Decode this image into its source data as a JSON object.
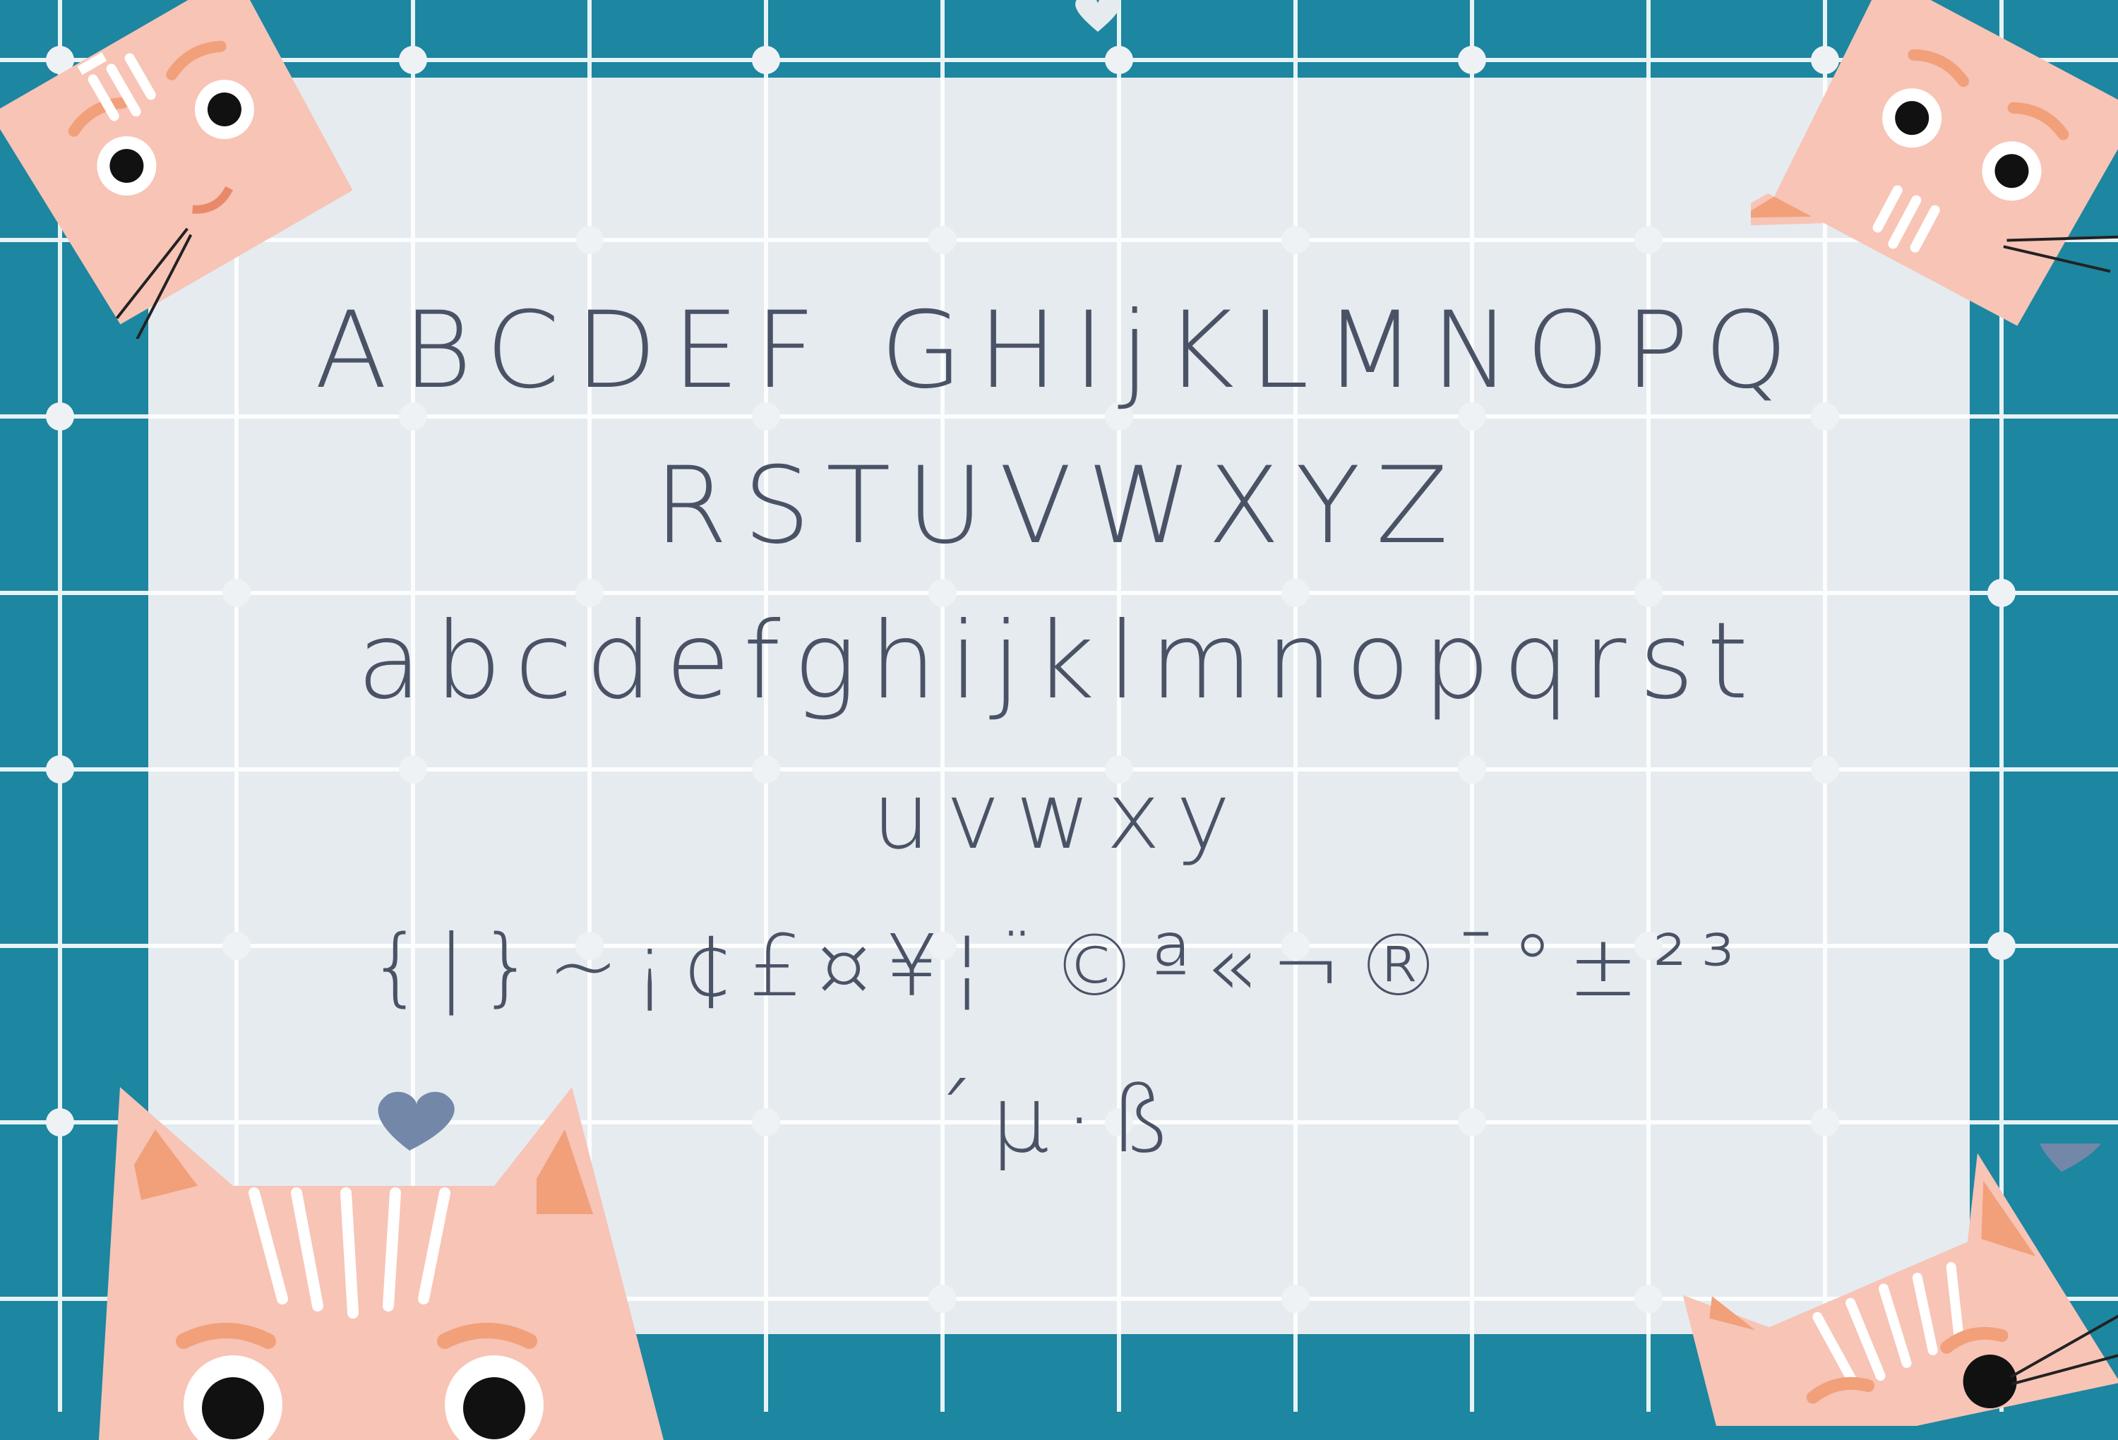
{
  "glyph_lines": [
    "ABCDEF GHIjKLMNOPQ",
    "RSTUVWXYZ",
    "abcdefghijklmnopqrst",
    "uvwxy",
    "{|}~¡¢£¤¥¦¨©ª«¬®¯°±²³",
    "´µ·ß"
  ],
  "colors": {
    "background_teal": "#1d86a0",
    "panel": "#e6ebf0",
    "grid_line": "#ffffff",
    "glyph_ink": "#4a5366",
    "cat_pink": "#f7c4b6",
    "cat_ear_inner": "#f1a07a",
    "heart": "#7388a8"
  },
  "decorations": [
    "cat-face-icon",
    "heart-icon",
    "grid-dot-icon"
  ]
}
